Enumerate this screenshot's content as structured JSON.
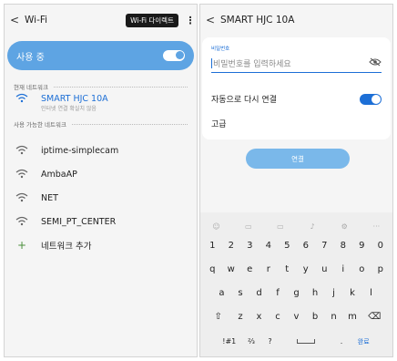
{
  "left": {
    "back_glyph": "<",
    "title": "Wi-Fi",
    "direct_label": "Wi-Fi 다이렉트",
    "more_glyph": "⋮",
    "master_label": "사용 중",
    "current_section": "현재 네트워크",
    "current_network": {
      "name": "SMART HJC 10A",
      "status": "인터넷 연결 확실치 않음"
    },
    "available_section": "사용 가능한 네트워크",
    "networks": [
      {
        "name": "iptime-simplecam"
      },
      {
        "name": "AmbaAP"
      },
      {
        "name": "NET"
      },
      {
        "name": "SEMI_PT_CENTER"
      }
    ],
    "add_glyph": "+",
    "add_network_label": "네트워크 추가"
  },
  "right": {
    "back_glyph": "<",
    "title": "SMART HJC 10A",
    "password_label": "비밀번호",
    "password_placeholder": "비밀번호를 입력하세요",
    "auto_reconnect_label": "자동으로 다시 연결",
    "auto_reconnect_on": true,
    "advanced_label": "고급",
    "connect_label": "연결",
    "keyboard": {
      "suggestions": [
        "☺",
        "▭",
        "▭",
        "♪",
        "⚙",
        "···"
      ],
      "row_numbers": [
        "1",
        "2",
        "3",
        "4",
        "5",
        "6",
        "7",
        "8",
        "9",
        "0"
      ],
      "row1": [
        "q",
        "w",
        "e",
        "r",
        "t",
        "y",
        "u",
        "i",
        "o",
        "p"
      ],
      "row2": [
        "a",
        "s",
        "d",
        "f",
        "g",
        "h",
        "j",
        "k",
        "l"
      ],
      "shift": "⇧",
      "row3": [
        "z",
        "x",
        "c",
        "v",
        "b",
        "n",
        "m"
      ],
      "backspace": "⌫",
      "sym_key": "!#1",
      "fraction_key": "⅔",
      "question_key": "?",
      "dot_key": ".",
      "done_key": "완료"
    }
  },
  "colors": {
    "accent": "#1d6fd6",
    "master_bar": "#5ea4e3",
    "connect_button": "#7ab8ea"
  },
  "icons": {
    "wifi": "wifi-icon",
    "back": "back-arrow-icon",
    "eye": "eye-off-icon",
    "plus": "plus-icon"
  }
}
